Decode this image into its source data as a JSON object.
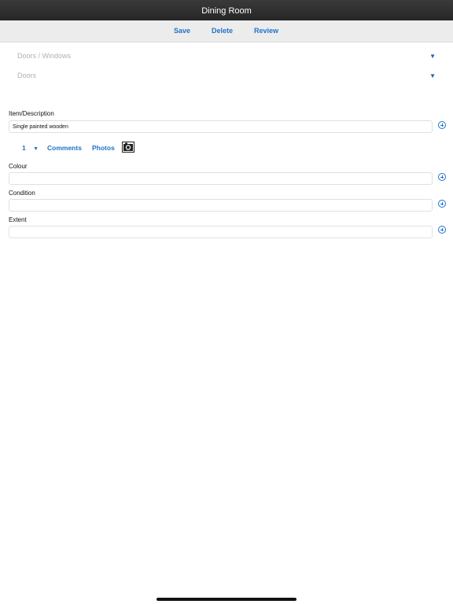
{
  "window": {
    "title": "Dining Room"
  },
  "toolbar": {
    "save_label": "Save",
    "delete_label": "Delete",
    "review_label": "Review"
  },
  "dropdowns": [
    {
      "value": "Doors / Windows"
    },
    {
      "value": "Doors"
    }
  ],
  "item_description": {
    "label": "Item/Description",
    "value": "Single painted wooden"
  },
  "sub_row": {
    "quantity": "1",
    "comments_label": "Comments",
    "photos_label": "Photos"
  },
  "colour": {
    "label": "Colour",
    "value": ""
  },
  "condition": {
    "label": "Condition",
    "value": ""
  },
  "extent": {
    "label": "Extent",
    "value": ""
  },
  "icons": {
    "add": "plus-circle-icon",
    "camera": "camera-icon",
    "dropdown": "triangle-down-icon"
  },
  "colors": {
    "accent": "#1f73c8",
    "titlebar": "#2e2e2e"
  }
}
